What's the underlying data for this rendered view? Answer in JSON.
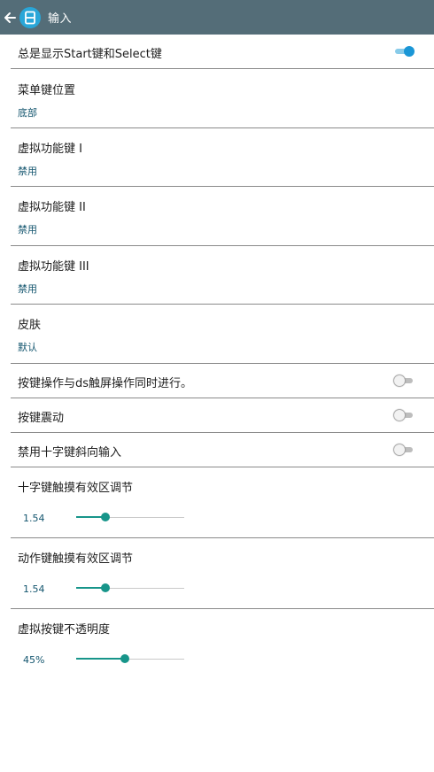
{
  "appbar": {
    "title": "输入"
  },
  "colors": {
    "appbar": "#546d78",
    "accent": "#1a96d6",
    "slider": "#17958a",
    "summary": "#14566f"
  },
  "settings": {
    "show_start_select": {
      "title": "总是显示Start键和Select键",
      "enabled": true
    },
    "menu_key_position": {
      "title": "菜单键位置",
      "value": "底部"
    },
    "virtual_key_1": {
      "title": "虚拟功能键 I",
      "value": "禁用"
    },
    "virtual_key_2": {
      "title": "虚拟功能键 II",
      "value": "禁用"
    },
    "virtual_key_3": {
      "title": "虚拟功能键 III",
      "value": "禁用"
    },
    "skin": {
      "title": "皮肤",
      "value": "默认"
    },
    "simultaneous_touch": {
      "title": "按键操作与ds触屏操作同时进行。",
      "enabled": false
    },
    "vibration": {
      "title": "按键震动",
      "enabled": false
    },
    "disable_diagonal": {
      "title": "禁用十字键斜向输入",
      "enabled": false
    },
    "dpad_touch_area": {
      "title": "十字键触摸有效区调节",
      "value_label": "1.54",
      "fraction": 0.27
    },
    "action_touch_area": {
      "title": "动作键触摸有效区调节",
      "value_label": "1.54",
      "fraction": 0.27
    },
    "opacity": {
      "title": "虚拟按键不透明度",
      "value_label": "45%",
      "fraction": 0.45
    }
  }
}
